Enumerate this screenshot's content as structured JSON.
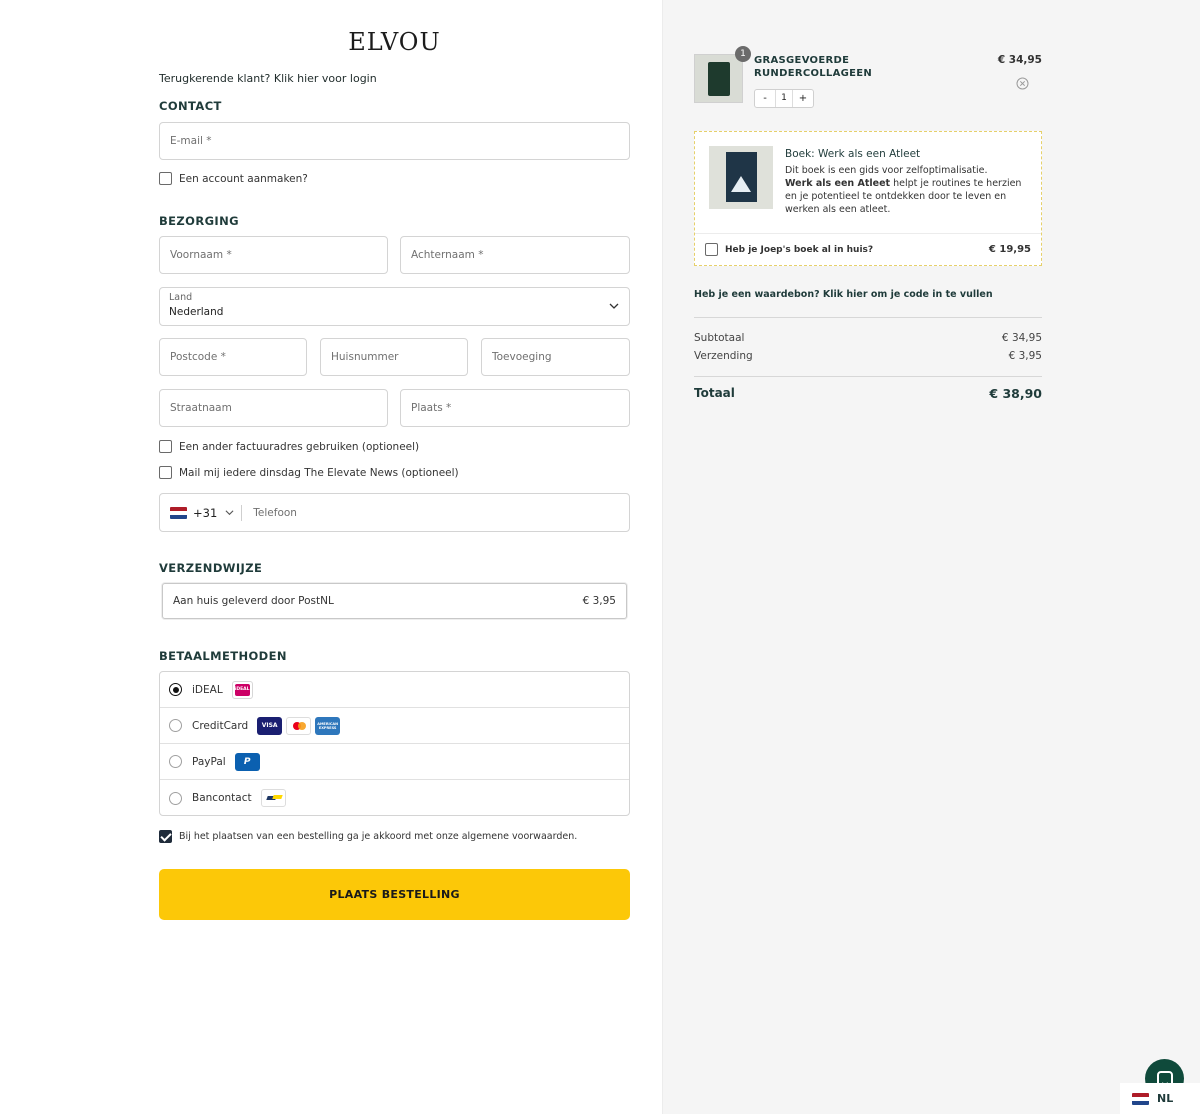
{
  "brand": {
    "logo": "ELVOU"
  },
  "login_prompt": {
    "text": "Terugkerende klant?",
    "link": "Klik hier voor login"
  },
  "contact": {
    "title": "CONTACT",
    "email_placeholder": "E-mail *",
    "create_account_label": "Een account aanmaken?"
  },
  "delivery": {
    "title": "BEZORGING",
    "first_name_placeholder": "Voornaam *",
    "last_name_placeholder": "Achternaam *",
    "country_label": "Land",
    "country_value": "Nederland",
    "postcode_placeholder": "Postcode *",
    "house_number_placeholder": "Huisnummer",
    "addition_placeholder": "Toevoeging",
    "street_placeholder": "Straatnaam",
    "city_placeholder": "Plaats *",
    "billing_address_label": "Een ander factuuradres gebruiken (optioneel)",
    "newsletter_label": "Mail mij iedere dinsdag The Elevate News (optioneel)",
    "phone_code": "+31",
    "phone_placeholder": "Telefoon"
  },
  "shipping": {
    "title": "VERZENDWIJZE",
    "option_label": "Aan huis geleverd door PostNL",
    "option_price": "€ 3,95"
  },
  "payment": {
    "title": "BETAALMETHODEN",
    "methods": [
      {
        "label": "iDEAL",
        "selected": true,
        "icons": [
          "ideal-icon"
        ]
      },
      {
        "label": "CreditCard",
        "selected": false,
        "icons": [
          "visa-icon",
          "mastercard-icon",
          "amex-icon"
        ]
      },
      {
        "label": "PayPal",
        "selected": false,
        "icons": [
          "paypal-icon"
        ]
      },
      {
        "label": "Bancontact",
        "selected": false,
        "icons": [
          "bancontact-icon"
        ]
      }
    ],
    "icon_text": {
      "visa": "VISA",
      "amex": "AMERICAN EXPRESS",
      "ideal": "iDEAL",
      "paypal": "P"
    }
  },
  "terms": {
    "label": "Bij het plaatsen van een bestelling ga je akkoord met onze algemene voorwaarden.",
    "checked": true
  },
  "place_order_label": "PLAATS BESTELLING",
  "cart": {
    "item": {
      "quantity_badge": "1",
      "name": "GRASGEVOERDE RUNDERCOLLAGEEN",
      "price": "€ 34,95",
      "quantity": "1",
      "minus": "-",
      "plus": "+"
    },
    "upsell": {
      "title": "Boek: Werk als een Atleet",
      "desc_intro": "Dit boek is een gids voor zelfoptimalisatie.",
      "desc_bold": "Werk als een Atleet",
      "desc_rest": " helpt je routines te herzien en je potentieel te ontdekken door te leven en werken als een atleet.",
      "checkbox_label": "Heb je Joep's boek al in huis?",
      "price": "€ 19,95"
    },
    "voucher_link": "Heb je een waardebon? Klik hier om je code in te vullen",
    "subtotal_label": "Subtotaal",
    "subtotal_value": "€ 34,95",
    "shipping_label": "Verzending",
    "shipping_value": "€ 3,95",
    "total_label": "Totaal",
    "total_value": "€ 38,90"
  },
  "language": {
    "code": "NL"
  },
  "colors": {
    "accent_button": "#fcc808",
    "heading": "#1f3b3a",
    "chat": "#0f4a3b",
    "summary_bg": "#f5f5f5"
  }
}
